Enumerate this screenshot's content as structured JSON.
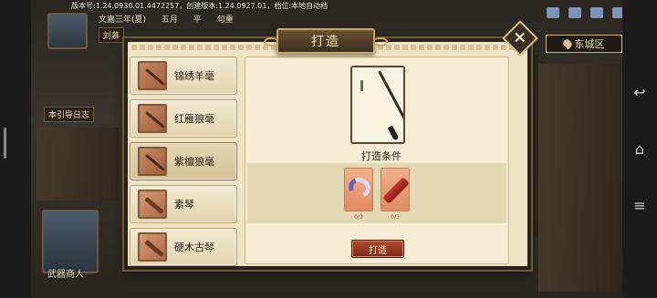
{
  "status": {
    "version": "版本号:1.24.0930.01.4472257，创建版本:1.24.0927.01，档位:本地自动档"
  },
  "top_info": [
    "文嘉三年(夏)",
    "五月",
    "平",
    "句重"
  ],
  "left_tags": [
    "刘慕",
    "本引导日志",
    "武器商人"
  ],
  "area": {
    "label": "东城区"
  },
  "dialog": {
    "title": "打造",
    "close_label": "×",
    "items": [
      {
        "label": "锦绣羊毫",
        "icon": "brush-icon"
      },
      {
        "label": "红雁狼毫",
        "icon": "brush-icon"
      },
      {
        "label": "紫檀狼毫",
        "icon": "brush-icon",
        "selected": true
      },
      {
        "label": "素琴",
        "icon": "qin-icon"
      },
      {
        "label": "硬木古琴",
        "icon": "qin-icon"
      }
    ],
    "condition_title": "打造条件",
    "materials": [
      {
        "name": "feather",
        "count": "0/2"
      },
      {
        "name": "redwood",
        "count": "0/3"
      }
    ],
    "craft_label": "打造"
  },
  "colors": {
    "panel_bg": "#efe3c6",
    "craft_button": "#a0402a",
    "frame": "#2a221a"
  }
}
